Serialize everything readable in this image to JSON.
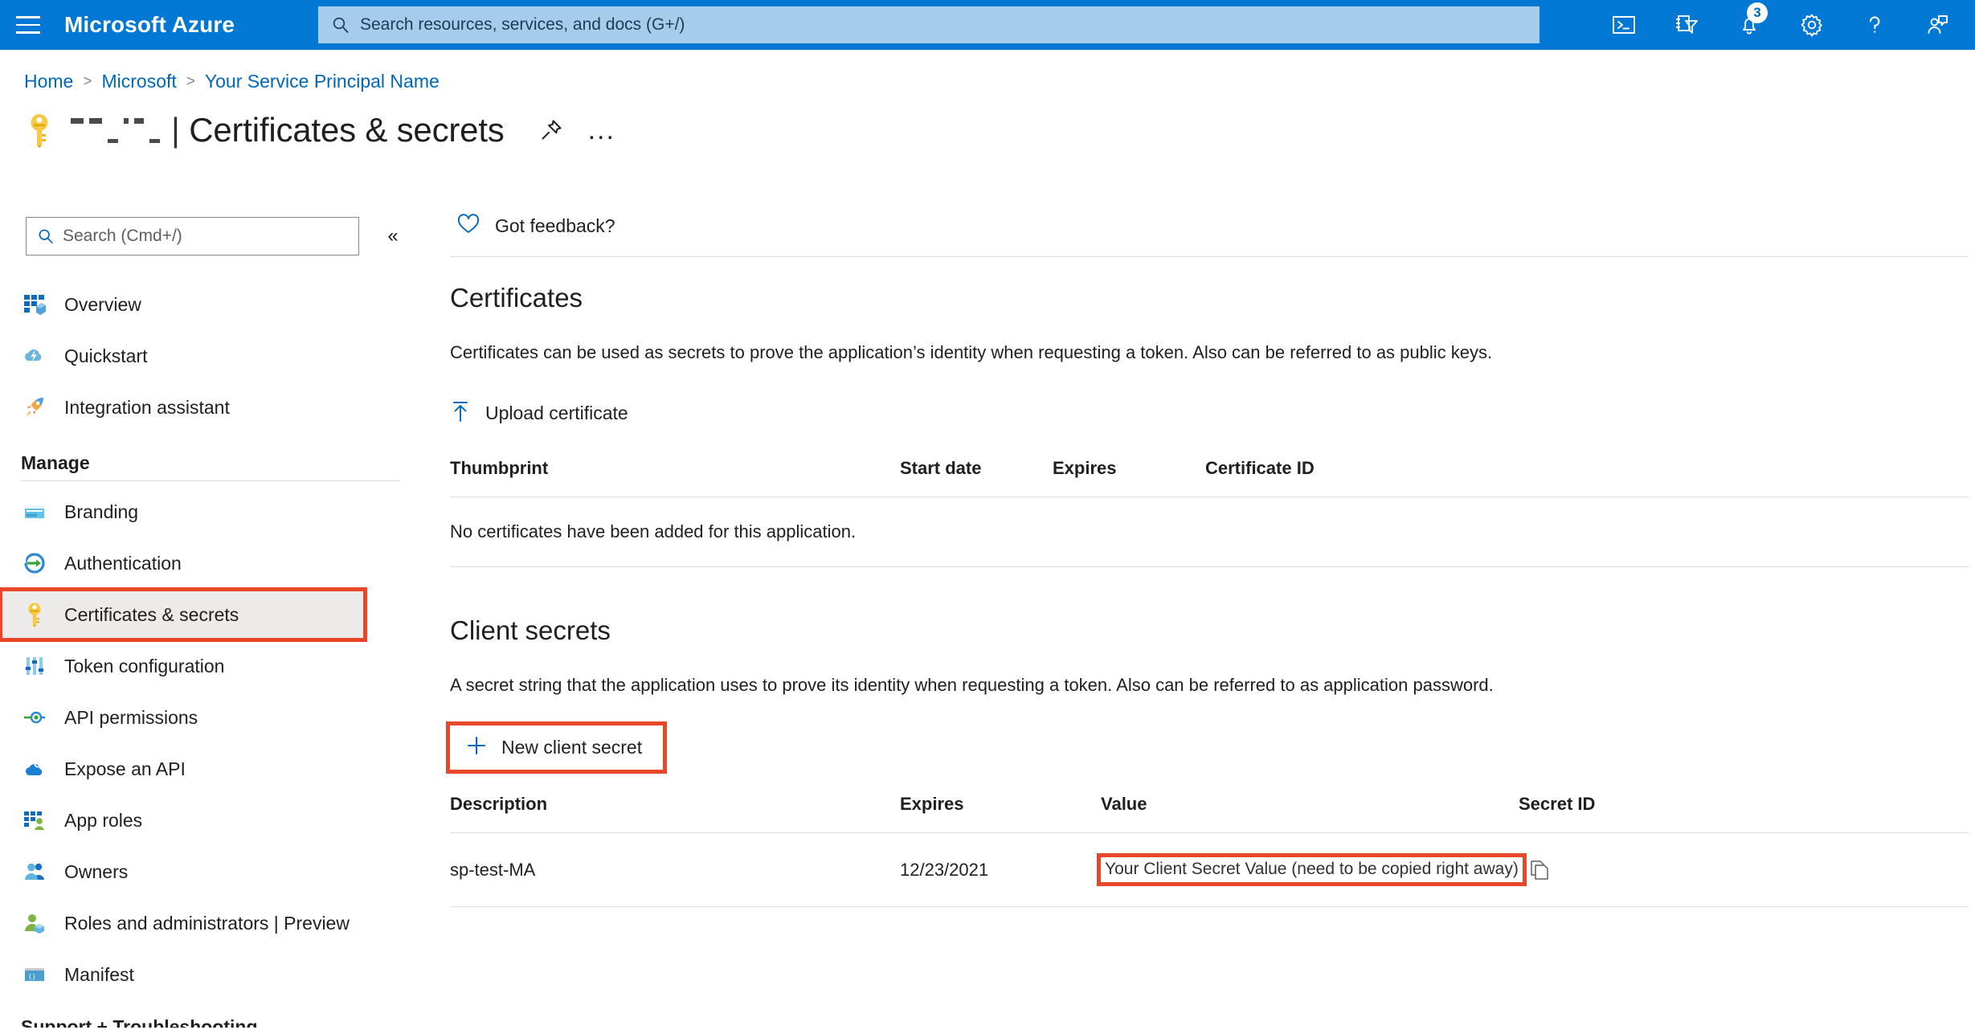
{
  "topbar": {
    "menu_label": "menu",
    "brand": "Microsoft Azure",
    "search_placeholder": "Search resources, services, and docs (G+/)",
    "search_value": "",
    "icons": [
      {
        "name": "cloud-shell-icon",
        "label": "Cloud Shell"
      },
      {
        "name": "directories-subscriptions-icon",
        "label": "Directories + subscriptions"
      },
      {
        "name": "notifications-bell-icon",
        "label": "Notifications",
        "badge": "3"
      },
      {
        "name": "settings-gear-icon",
        "label": "Settings"
      },
      {
        "name": "help-question-icon",
        "label": "Help"
      },
      {
        "name": "feedback-person-icon",
        "label": "Feedback"
      }
    ]
  },
  "breadcrumb": {
    "items": [
      "Home",
      "Microsoft",
      "Your Service Principal Name"
    ],
    "separator": ">"
  },
  "page": {
    "icon": "key-icon",
    "redacted_name": "",
    "pipe": "|",
    "title": "Certificates & secrets",
    "pin_label": "Pin to dashboard",
    "more_label": "..."
  },
  "sidebar": {
    "search_placeholder": "Search (Cmd+/)",
    "search_value": "",
    "collapse_label": "«",
    "top_items": [
      {
        "label": "Overview",
        "icon": "overview-grid-icon"
      },
      {
        "label": "Quickstart",
        "icon": "quickstart-cloud-icon"
      },
      {
        "label": "Integration assistant",
        "icon": "rocket-icon"
      }
    ],
    "manage_header": "Manage",
    "manage_items": [
      {
        "label": "Branding",
        "icon": "branding-window-icon",
        "selected": false
      },
      {
        "label": "Authentication",
        "icon": "authentication-arrow-icon",
        "selected": false
      },
      {
        "label": "Certificates & secrets",
        "icon": "key-icon",
        "selected": true,
        "annotated": true
      },
      {
        "label": "Token configuration",
        "icon": "token-bars-icon",
        "selected": false
      },
      {
        "label": "API permissions",
        "icon": "api-permissions-icon",
        "selected": false
      },
      {
        "label": "Expose an API",
        "icon": "expose-api-cloud-icon",
        "selected": false
      },
      {
        "label": "App roles",
        "icon": "app-roles-icon",
        "selected": false
      },
      {
        "label": "Owners",
        "icon": "owners-people-icon",
        "selected": false
      },
      {
        "label": "Roles and administrators | Preview",
        "icon": "roles-admin-icon",
        "selected": false
      },
      {
        "label": "Manifest",
        "icon": "manifest-braces-icon",
        "selected": false
      }
    ],
    "support_header": "Support + Troubleshooting"
  },
  "main": {
    "feedback": {
      "label": "Got feedback?",
      "icon": "heart-icon"
    },
    "certificates": {
      "title": "Certificates",
      "description": "Certificates can be used as secrets to prove the application’s identity when requesting a token. Also can be referred to as public keys.",
      "upload_button": {
        "label": "Upload certificate",
        "icon": "upload-icon"
      },
      "columns": [
        "Thumbprint",
        "Start date",
        "Expires",
        "Certificate ID"
      ],
      "empty_message": "No certificates have been added for this application."
    },
    "client_secrets": {
      "title": "Client secrets",
      "description": "A secret string that the application uses to prove its identity when requesting a token. Also can be referred to as application password.",
      "new_button": {
        "label": "New client secret",
        "icon": "plus-icon"
      },
      "columns": [
        "Description",
        "Expires",
        "Value",
        "Secret ID"
      ],
      "rows": [
        {
          "description": "sp-test-MA",
          "expires": "12/23/2021",
          "value": "Your Client Secret Value (need to be copied right away)",
          "secret_id": "",
          "copy_icon": "copy-icon"
        }
      ]
    }
  },
  "colors": {
    "azure_blue": "#0078d4",
    "link_blue": "#0067b8",
    "annotation_red": "#e8472a",
    "selected_gray": "#edebe9"
  }
}
